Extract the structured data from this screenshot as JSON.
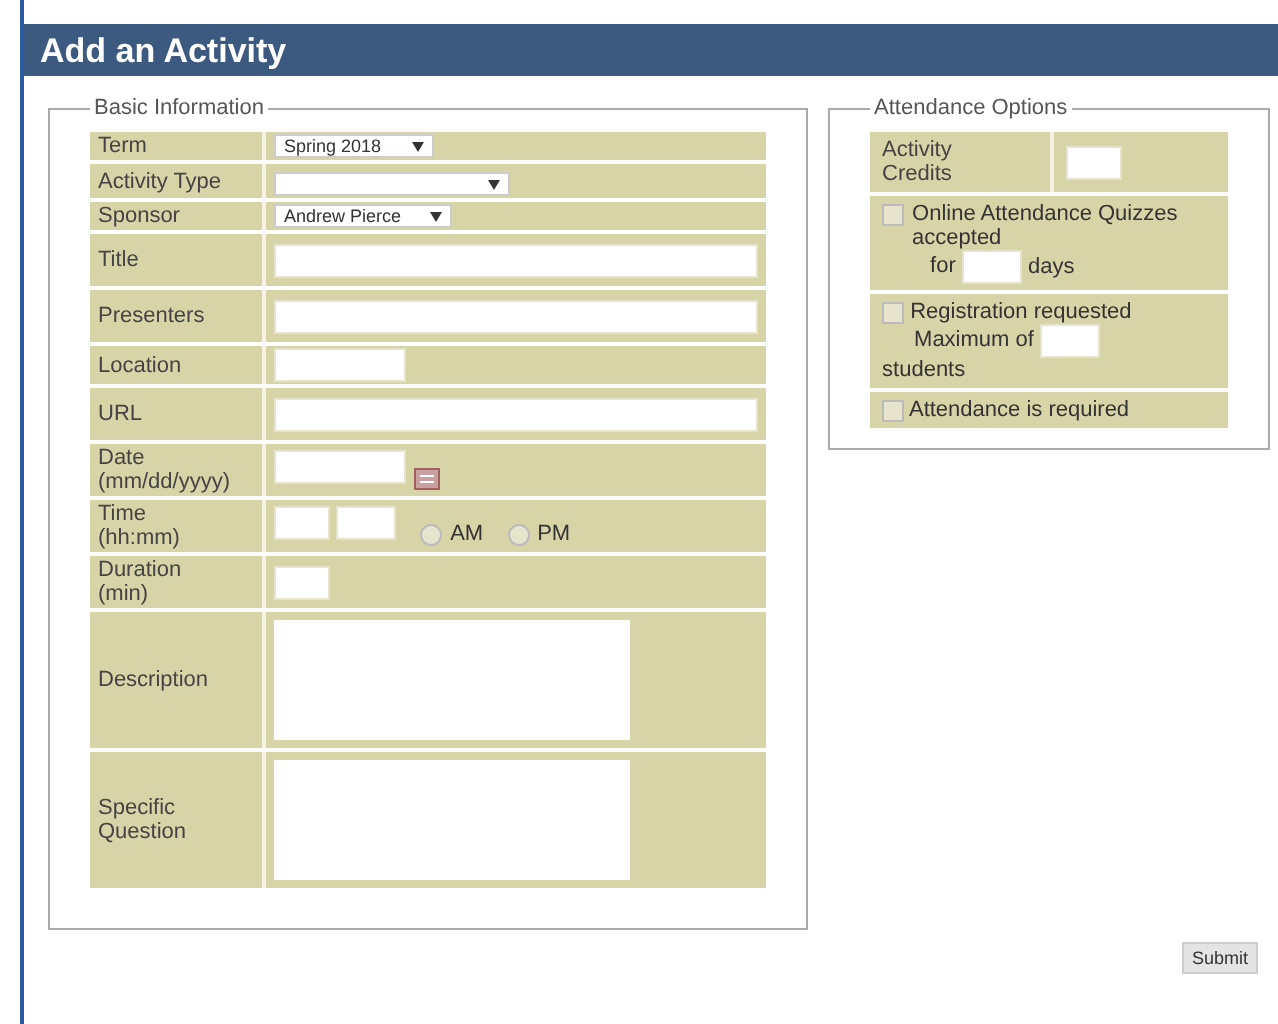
{
  "title": "Add an Activity",
  "basic_information": {
    "legend": "Basic Information",
    "rows": [
      {
        "label": "Term",
        "kind": "select",
        "value": "Spring 2018"
      },
      {
        "label": "Activity Type",
        "kind": "select",
        "value": ""
      },
      {
        "label": "Sponsor",
        "kind": "select",
        "value": "Andrew Pierce"
      },
      {
        "label": "Title",
        "kind": "text"
      },
      {
        "label": "Presenters",
        "kind": "text"
      },
      {
        "label": "Location",
        "kind": "short_text"
      },
      {
        "label": "URL",
        "kind": "text"
      },
      {
        "label": "Date\n(mm/dd/yyyy)",
        "kind": "date"
      },
      {
        "label": "Time\n(hh:mm)",
        "kind": "time",
        "options": [
          {
            "label": "AM",
            "checked": false
          },
          {
            "label": "PM",
            "checked": false
          }
        ]
      },
      {
        "label": "Duration\n(min)",
        "kind": "short"
      },
      {
        "label": "Description",
        "kind": "textarea"
      },
      {
        "label": "Specific\nQuestion",
        "kind": "textarea"
      }
    ]
  },
  "attendance_options": {
    "legend": "Attendance Options",
    "credits_label": "Activity\nCredits",
    "online": {
      "checked": false,
      "label": "Online Attendance Quizzes accepted",
      "for": "for",
      "days": "days"
    },
    "registration": {
      "checked": false,
      "label": "Registration requested",
      "maximum": "Maximum of",
      "students": "students"
    },
    "required": {
      "checked": false,
      "label": "Attendance is required"
    }
  },
  "submit": "Submit"
}
